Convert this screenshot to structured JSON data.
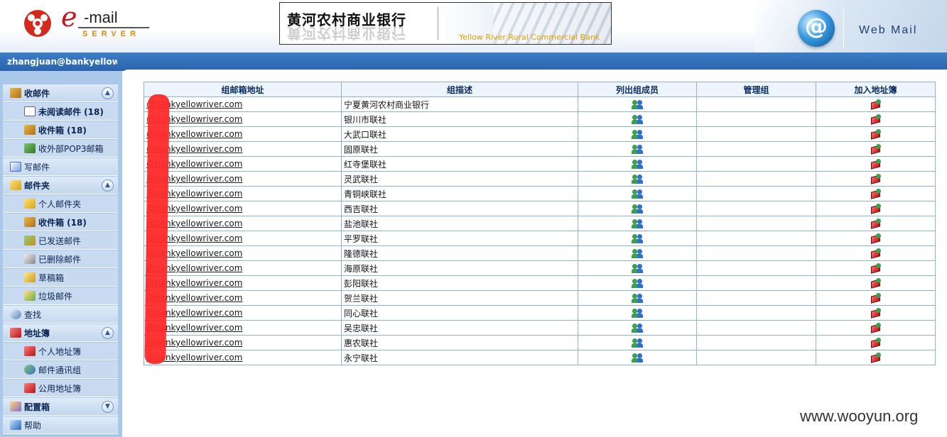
{
  "header": {
    "logo_e": "e",
    "logo_mail": "-mail",
    "logo_server": "SERVER",
    "banner_cn": "黄河农村商业银行",
    "banner_en": "Yellow River Rural Commercial Bank",
    "webmail": "Web Mail"
  },
  "userbar": {
    "email": "zhangjuan@bankyellowri..."
  },
  "sidebar": {
    "inbox_section": "收邮件",
    "unread": "未阅读邮件 (18)",
    "inbox": "收件箱 (18)",
    "pop3": "收外部POP3邮箱",
    "compose": "写邮件",
    "folders_section": "邮件夹",
    "personal_folder": "个人邮件夹",
    "inbox2": "收件箱 (18)",
    "sent": "已发送邮件",
    "deleted": "已删除邮件",
    "drafts": "草稿箱",
    "junk": "垃圾邮件",
    "search": "查找",
    "addressbook_section": "地址簿",
    "personal_addressbook": "个人地址簿",
    "mail_groups": "邮件通讯组",
    "public_addressbook": "公用地址簿",
    "config_section": "配置箱",
    "help": "帮助"
  },
  "table": {
    "headers": [
      "组邮箱地址",
      "组描述",
      "列出组成员",
      "管理组",
      "加入地址簿"
    ],
    "rows": [
      {
        "address": "@bankyellowriver.com",
        "desc": "宁夏黄河农村商业银行"
      },
      {
        "address": "@bankyellowriver.com",
        "desc": "银川市联社"
      },
      {
        "address": "@bankyellowriver.com",
        "desc": "大武口联社"
      },
      {
        "address": "@bankyellowriver.com",
        "desc": "固原联社"
      },
      {
        "address": "@bankyellowriver.com",
        "desc": "红寺堡联社"
      },
      {
        "address": "@bankyellowriver.com",
        "desc": "灵武联社"
      },
      {
        "address": "@bankyellowriver.com",
        "desc": "青铜峡联社"
      },
      {
        "address": "@bankyellowriver.com",
        "desc": "西吉联社"
      },
      {
        "address": "@bankyellowriver.com",
        "desc": "盐池联社"
      },
      {
        "address": "@bankyellowriver.com",
        "desc": "平罗联社"
      },
      {
        "address": "@bankyellowriver.com",
        "desc": "隆德联社"
      },
      {
        "address": "@bankyellowriver.com",
        "desc": "海原联社"
      },
      {
        "address": "@bankyellowriver.com",
        "desc": "彭阳联社"
      },
      {
        "address": "@bankyellowriver.com",
        "desc": "贺兰联社"
      },
      {
        "address": "@bankyellowriver.com",
        "desc": "同心联社"
      },
      {
        "address": "@bankyellowriver.com",
        "desc": "吴忠联社"
      },
      {
        "address": "@bankyellowriver.com",
        "desc": "惠农联社"
      },
      {
        "address": "@bankyellowriver.com",
        "desc": "永宁联社"
      }
    ]
  },
  "watermark": "www.wooyun.org"
}
